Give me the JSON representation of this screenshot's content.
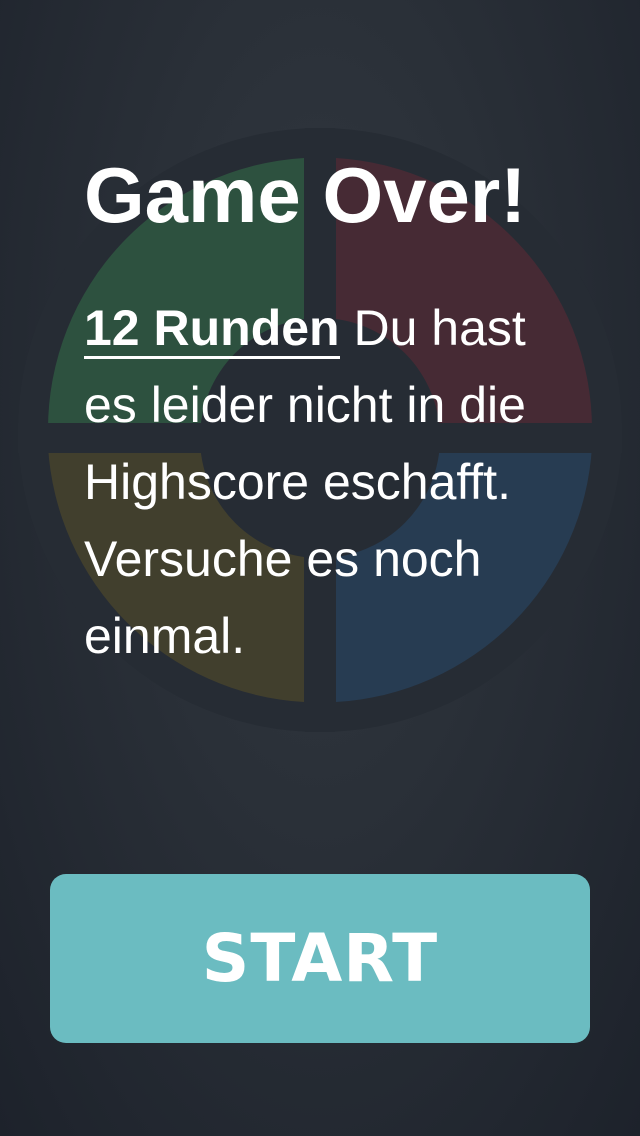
{
  "game_over": {
    "title": "Game Over!",
    "rounds": "12 Runden",
    "message": "Du hast es leider nicht in die Highscore eschafft. Versuche es noch einmal."
  },
  "start_button": {
    "label": "START"
  },
  "colors": {
    "accent": "#6bbcc1",
    "background": "#2a3038",
    "quadrant_green": "#2f5540",
    "quadrant_red": "#4a2a34",
    "quadrant_yellow": "#45412c",
    "quadrant_blue": "#283e55"
  }
}
